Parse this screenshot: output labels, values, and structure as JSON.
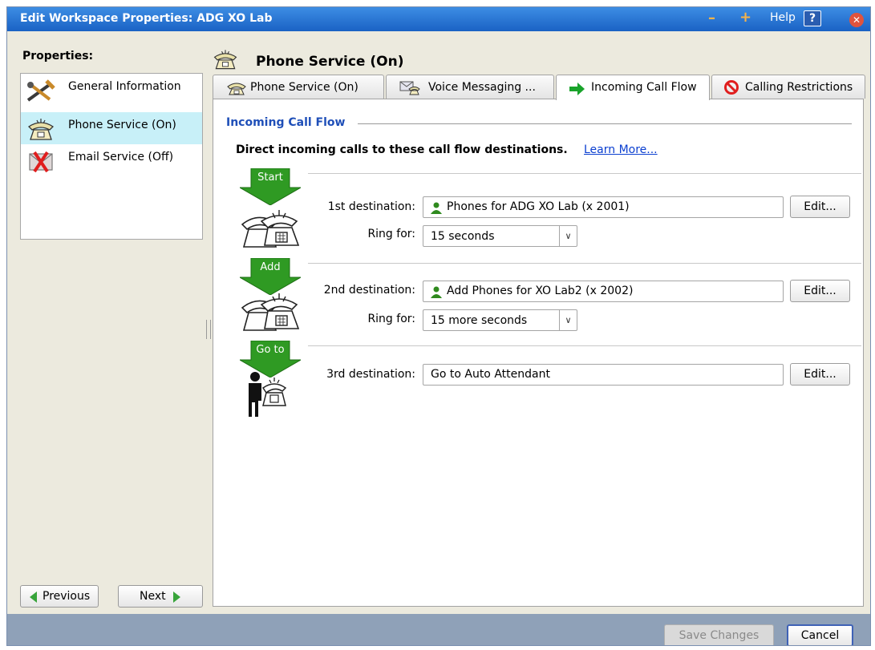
{
  "window": {
    "title": "Edit Workspace Properties: ADG XO Lab",
    "help_label": "Help",
    "help_icon": "?"
  },
  "sidebar": {
    "heading": "Properties:",
    "items": [
      {
        "label": "General Information",
        "icon": "tools-icon"
      },
      {
        "label": "Phone Service (On)",
        "icon": "phone-icon",
        "selected": true
      },
      {
        "label": "Email Service (Off)",
        "icon": "email-disabled-icon"
      }
    ],
    "previous_label": "Previous",
    "next_label": "Next"
  },
  "header": {
    "title": "Phone Service (On)"
  },
  "tabs": [
    {
      "label": "Phone Service (On)",
      "icon": "phone-icon"
    },
    {
      "label": "Voice Messaging ...",
      "icon": "voicemail-icon"
    },
    {
      "label": "Incoming Call Flow",
      "icon": "green-arrow-icon",
      "active": true
    },
    {
      "label": "Calling Restrictions",
      "icon": "no-entry-icon"
    }
  ],
  "call_flow": {
    "section_title": "Incoming Call Flow",
    "intro": "Direct incoming calls to these call flow destinations.",
    "learn_more": "Learn More...",
    "edit_label": "Edit...",
    "ring_label": "Ring for:",
    "steps": [
      {
        "badge": "Start",
        "label": "1st destination:",
        "value": "Phones for ADG XO Lab (x 2001)",
        "ring": "15 seconds"
      },
      {
        "badge": "Add",
        "label": "2nd destination:",
        "value": "Add Phones for XO Lab2 (x 2002)",
        "ring": "15 more seconds"
      },
      {
        "badge": "Go to",
        "label": "3rd destination:",
        "value": "Go to Auto Attendant"
      }
    ]
  },
  "footer": {
    "save_label": "Save Changes",
    "cancel_label": "Cancel"
  },
  "colors": {
    "title_bar": "#1a62c4",
    "section_title": "#1f4fb8",
    "flow_arrow": "#2f9a23",
    "selected_item": "#c8f0f8"
  }
}
